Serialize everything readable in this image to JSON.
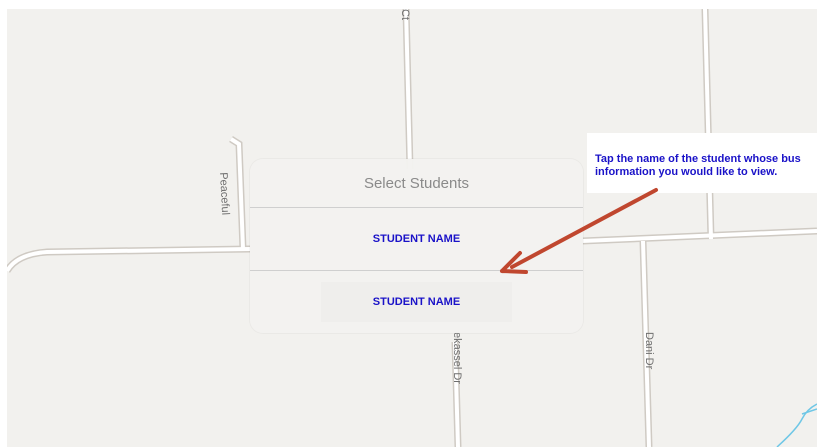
{
  "map": {
    "streets": {
      "top_partial": "Ct",
      "peaceful": "Peaceful",
      "kassel": "ekassel Dr",
      "dani": "Dani Dr"
    },
    "colors": {
      "background": "#f2f1ee",
      "road_fill": "#ffffff",
      "road_edge": "#cfcac3",
      "water": "#6fc7e6"
    }
  },
  "dialog": {
    "title": "Select Students",
    "options": [
      {
        "label": "STUDENT NAME"
      },
      {
        "label": "STUDENT NAME"
      }
    ]
  },
  "callout": {
    "text": "Tap the name of the student whose bus information you would like to view."
  },
  "colors": {
    "accent": "#1a12c8",
    "arrow": "#c0472f"
  }
}
